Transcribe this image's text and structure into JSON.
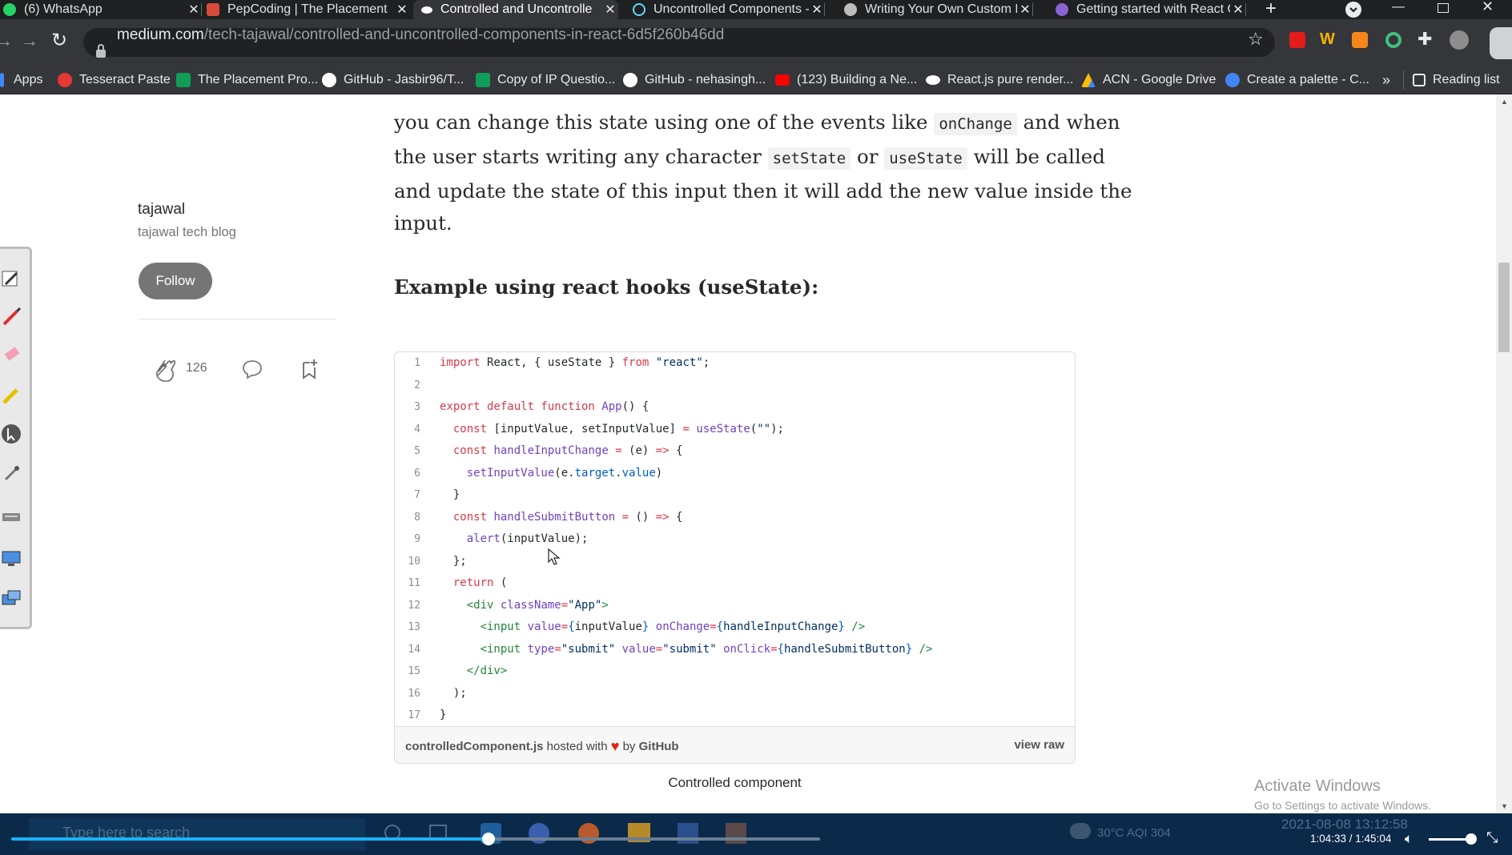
{
  "browser": {
    "tabs": [
      {
        "title": "(6) WhatsApp",
        "favicon_color": "#25d366",
        "active": false
      },
      {
        "title": "PepCoding | The Placement",
        "favicon_color": "#d84b3a",
        "active": false
      },
      {
        "title": "Controlled and Uncontrolle",
        "favicon_color": "#ffffff",
        "active": true
      },
      {
        "title": "Uncontrolled Components -",
        "favicon_color": "#61dafb",
        "active": false
      },
      {
        "title": "Writing Your Own Custom F",
        "favicon_color": "#bdbdbd",
        "active": false
      },
      {
        "title": "Getting started with React C",
        "favicon_color": "#8a63d2",
        "active": false
      }
    ],
    "new_tab_icon": "plus-icon",
    "url_host": "medium.com",
    "url_path": "/tech-tajawal/controlled-and-uncontrolled-components-in-react-6d5f260b46dd",
    "bookmarks": [
      {
        "label": "Apps",
        "icon_color": "#4285f4"
      },
      {
        "label": "Tesseract Paste",
        "icon_color": "#e53935"
      },
      {
        "label": "The Placement Pro...",
        "icon_color": "#0f9d58"
      },
      {
        "label": "GitHub - Jasbir96/T...",
        "icon_color": "#ffffff"
      },
      {
        "label": "Copy of IP Questio...",
        "icon_color": "#0f9d58"
      },
      {
        "label": "GitHub - nehasingh...",
        "icon_color": "#ffffff"
      },
      {
        "label": "(123) Building a Ne...",
        "icon_color": "#ff0000"
      },
      {
        "label": "React.js pure render...",
        "icon_color": "#ffffff"
      },
      {
        "label": "ACN - Google Drive",
        "icon_color": "#fbbc04"
      },
      {
        "label": "Create a palette - C...",
        "icon_color": "#4285f4"
      }
    ],
    "bookmarks_overflow": "»",
    "reading_list": "Reading list"
  },
  "sidebar": {
    "author": "tajawal",
    "publication": "tajawal tech blog",
    "follow_label": "Follow",
    "claps": "126"
  },
  "article": {
    "para_line1_pre": "you can change this state using one of the events like",
    "para_line1_code": "onChange",
    "para_line1_post": "and when",
    "para_line2_pre": "the user starts writing any character",
    "para_line2_code1": "setState",
    "para_line2_mid": "or",
    "para_line2_code2": "useState",
    "para_line2_post": "will be called",
    "para_line3": "and update the state of this input then it will add the new value inside the",
    "para_line4": "input.",
    "heading": "Example using react hooks (useState):",
    "caption": "Controlled component"
  },
  "gist": {
    "filename": "controlledComponent.js",
    "hosted_with": "hosted with",
    "by": "by",
    "github": "GitHub",
    "view_raw": "view raw"
  },
  "watermark": {
    "title": "Activate Windows",
    "subtitle": "Go to Settings to activate Windows."
  },
  "player": {
    "time": "1:04:33 / 1:45:04",
    "progress": 0.5902
  },
  "taskbar": {
    "search_placeholder": "Type here to search",
    "weather": "30°C  AQI 304",
    "datetime": "2021-08-08  13:12:58"
  }
}
